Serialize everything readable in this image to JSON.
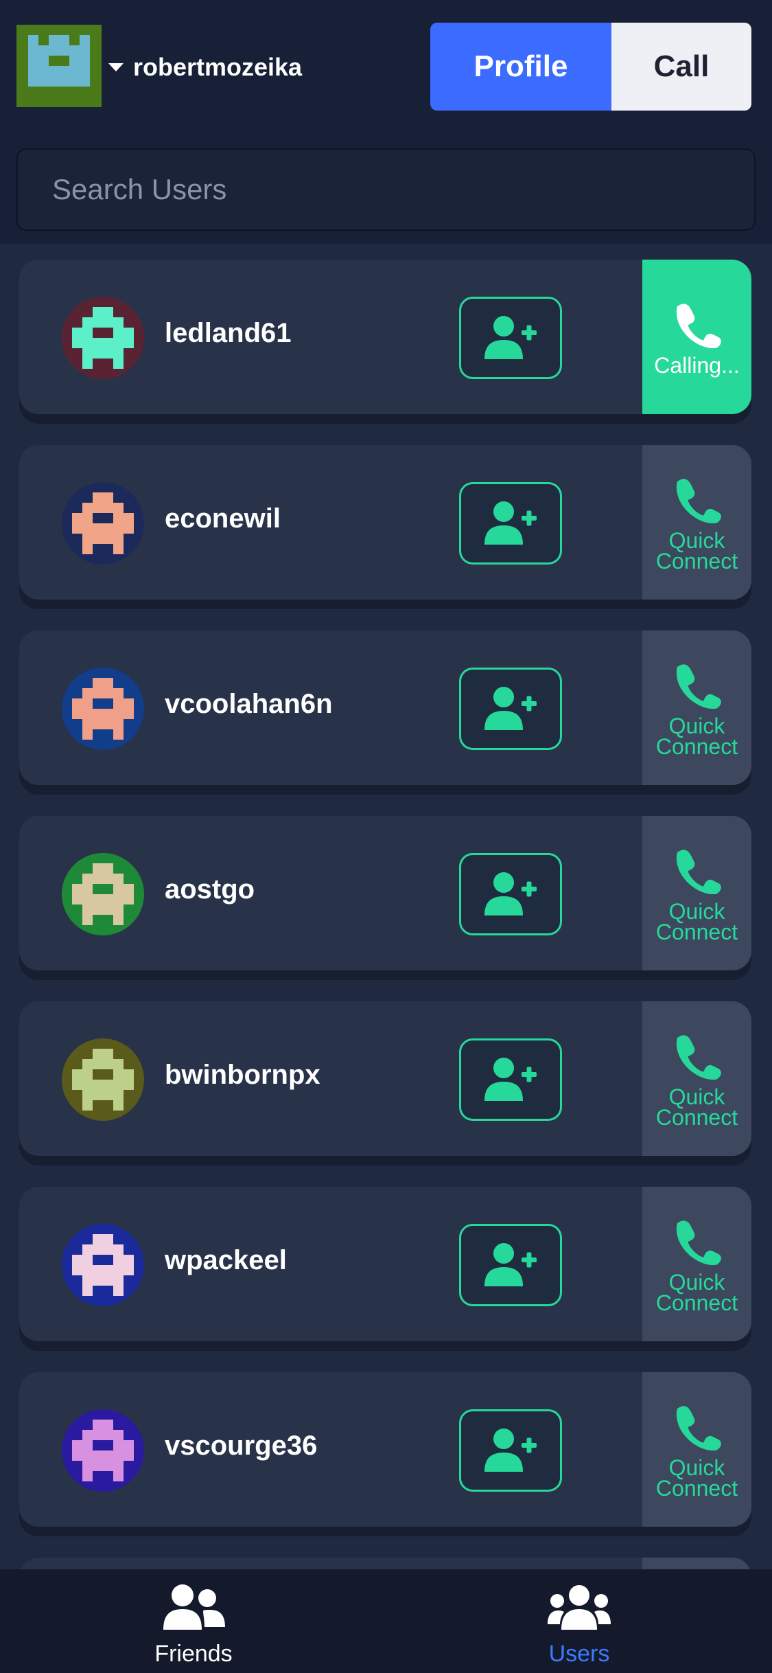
{
  "header": {
    "username": "robertmozeika",
    "profile_label": "Profile",
    "call_label": "Call"
  },
  "search": {
    "placeholder": "Search Users"
  },
  "colors": {
    "accent_green": "#26d99a",
    "accent_blue": "#3b6bff",
    "background": "#1f2a40",
    "card": "#283249"
  },
  "users": [
    {
      "name": "ledland61",
      "status_label": "Calling...",
      "avatar_bg": "#5a2333",
      "avatar_fg": "#5cf0c8"
    },
    {
      "name": "econewil",
      "status_label": "Quick Connect",
      "avatar_bg": "#1b2a5a",
      "avatar_fg": "#f0a588"
    },
    {
      "name": "vcoolahan6n",
      "status_label": "Quick Connect",
      "avatar_bg": "#113d8a",
      "avatar_fg": "#f0a088"
    },
    {
      "name": "aostgo",
      "status_label": "Quick Connect",
      "avatar_bg": "#1e8a38",
      "avatar_fg": "#d8c8a0"
    },
    {
      "name": "bwinbornpx",
      "status_label": "Quick Connect",
      "avatar_bg": "#5a5a1a",
      "avatar_fg": "#bcd08a"
    },
    {
      "name": "wpackeel",
      "status_label": "Quick Connect",
      "avatar_bg": "#1a2a9a",
      "avatar_fg": "#f0d0e0"
    },
    {
      "name": "vscourge36",
      "status_label": "Quick Connect",
      "avatar_bg": "#2a1aa0",
      "avatar_fg": "#d890e0"
    }
  ],
  "nav": {
    "friends_label": "Friends",
    "users_label": "Users"
  },
  "icons": {
    "add_friend": "user-plus-icon",
    "phone": "phone-icon",
    "friends": "user-friends-icon",
    "users": "users-icon"
  }
}
